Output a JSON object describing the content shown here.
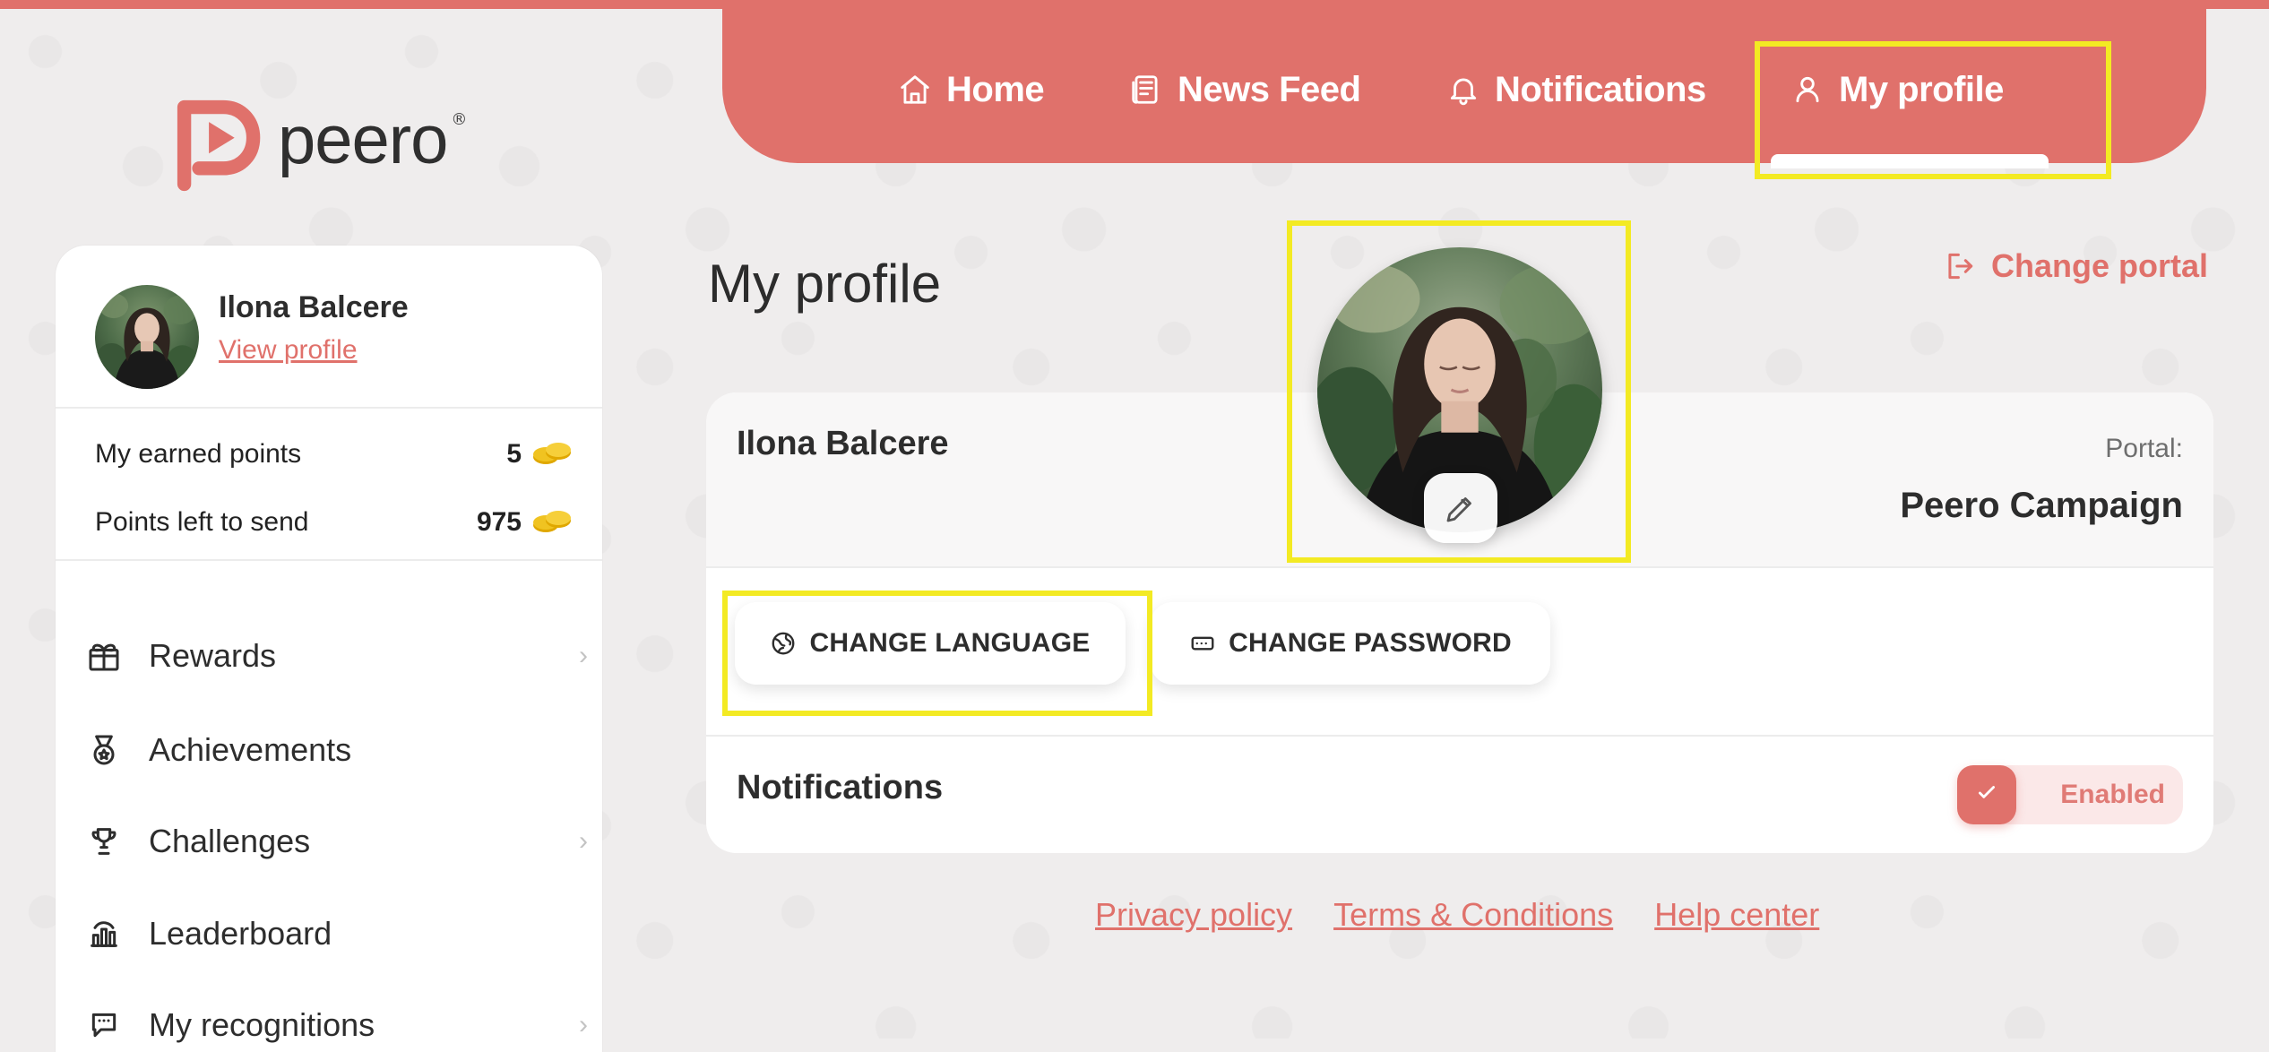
{
  "brand": {
    "name": "peero",
    "registered_mark": "®",
    "accent": "#e0716b",
    "highlight": "#f3ea23"
  },
  "topnav": {
    "items": [
      {
        "label": "Home",
        "icon": "home-icon"
      },
      {
        "label": "News Feed",
        "icon": "news-feed-icon"
      },
      {
        "label": "Notifications",
        "icon": "bell-icon"
      },
      {
        "label": "My profile",
        "icon": "user-icon",
        "active": true
      }
    ]
  },
  "sidebar": {
    "user": {
      "name": "Ilona Balcere",
      "view_profile": "View profile"
    },
    "points": [
      {
        "label": "My earned points",
        "value": "5",
        "icon": "coins-icon"
      },
      {
        "label": "Points left to send",
        "value": "975",
        "icon": "coins-icon"
      }
    ],
    "menu": [
      {
        "label": "Rewards",
        "icon": "gift-icon",
        "has_chevron": true
      },
      {
        "label": "Achievements",
        "icon": "medal-icon",
        "has_chevron": false
      },
      {
        "label": "Challenges",
        "icon": "trophy-icon",
        "has_chevron": true
      },
      {
        "label": "Leaderboard",
        "icon": "leaderboard-icon",
        "has_chevron": false
      },
      {
        "label": "My recognitions",
        "icon": "recognitions-icon",
        "has_chevron": true
      }
    ]
  },
  "main": {
    "page_title": "My profile",
    "change_portal": "Change portal",
    "profile_card": {
      "name": "Ilona Balcere",
      "portal_label": "Portal:",
      "portal_value": "Peero Campaign",
      "change_language": "CHANGE LANGUAGE",
      "change_password": "CHANGE PASSWORD",
      "notifications_label": "Notifications",
      "notifications_status": "Enabled",
      "notifications_enabled": true
    },
    "avatar_edit_icon": "pencil-icon"
  },
  "footer": {
    "links": [
      "Privacy policy",
      "Terms & Conditions",
      "Help center"
    ]
  }
}
